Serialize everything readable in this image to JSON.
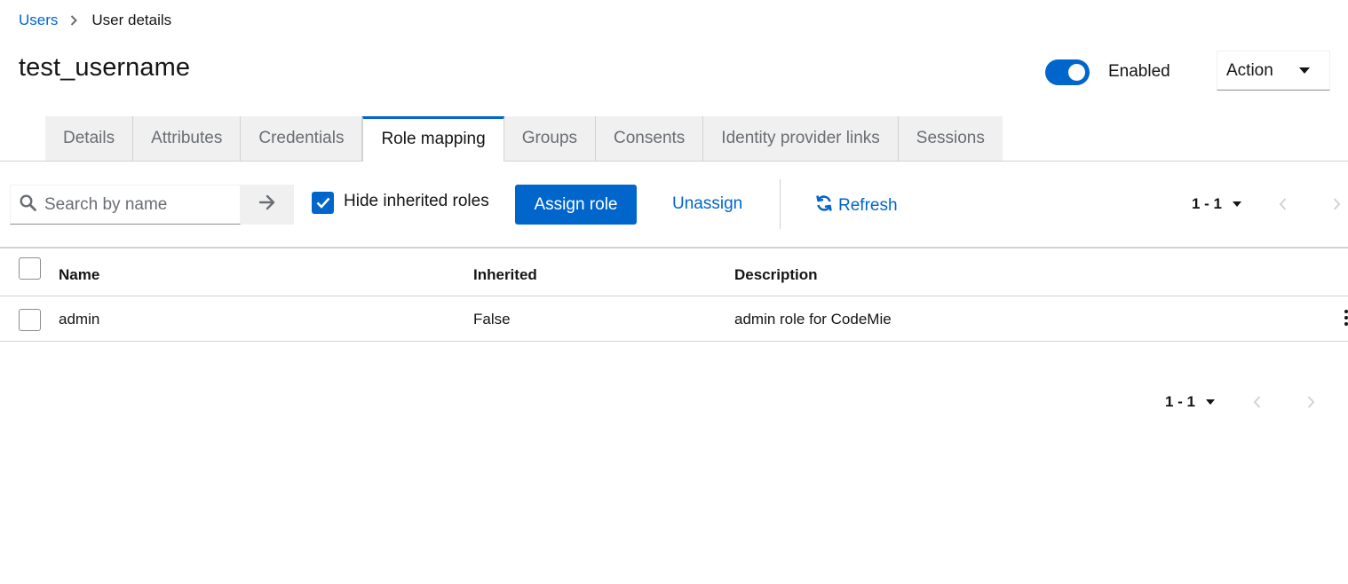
{
  "breadcrumb": {
    "parent": "Users",
    "current": "User details"
  },
  "header": {
    "title": "test_username",
    "enabled_label": "Enabled",
    "enabled": true,
    "action_label": "Action"
  },
  "tabs": [
    {
      "label": "Details",
      "active": false
    },
    {
      "label": "Attributes",
      "active": false
    },
    {
      "label": "Credentials",
      "active": false
    },
    {
      "label": "Role mapping",
      "active": true
    },
    {
      "label": "Groups",
      "active": false
    },
    {
      "label": "Consents",
      "active": false
    },
    {
      "label": "Identity provider links",
      "active": false
    },
    {
      "label": "Sessions",
      "active": false
    }
  ],
  "toolbar": {
    "search_placeholder": "Search by name",
    "hide_inherited_label": "Hide inherited roles",
    "hide_inherited_checked": true,
    "assign_label": "Assign role",
    "unassign_label": "Unassign",
    "refresh_label": "Refresh"
  },
  "pagination": {
    "top_range": "1 - 1",
    "bottom_range": "1 - 1"
  },
  "table": {
    "columns": [
      "Name",
      "Inherited",
      "Description"
    ],
    "rows": [
      {
        "name": "admin",
        "inherited": "False",
        "description": "admin role for CodeMie"
      }
    ]
  },
  "colors": {
    "accent": "#0066cc",
    "text": "#151515",
    "muted": "#6a6e73",
    "border": "#d2d2d2",
    "tab_bg": "#f0f0f0"
  },
  "icons": {
    "breadcrumb_separator": "chevron-right-icon",
    "search": "search-icon",
    "search_go": "arrow-right-icon",
    "refresh": "sync-icon",
    "dropdown": "caret-down-icon",
    "prev": "angle-left-icon",
    "next": "angle-right-icon",
    "row_actions": "kebab-icon"
  }
}
